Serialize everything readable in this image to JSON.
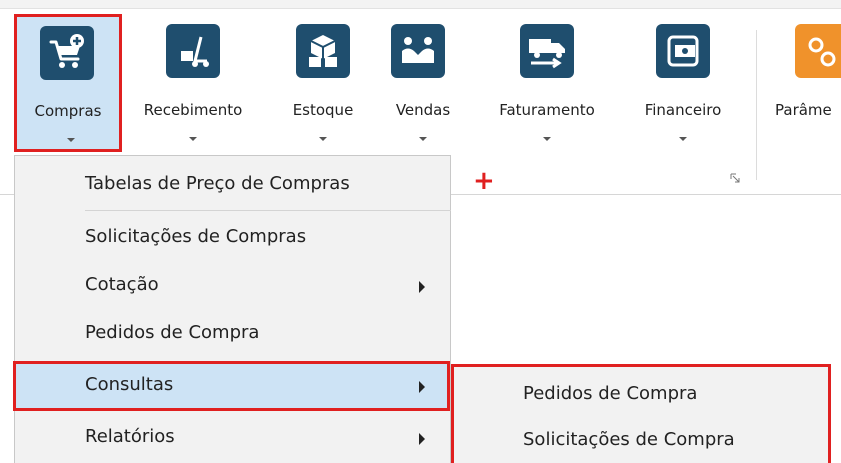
{
  "ribbon": {
    "buttons": [
      {
        "label": "Compras",
        "icon": "shopping-cart-plus-icon"
      },
      {
        "label": "Recebimento",
        "icon": "hand-truck-icon"
      },
      {
        "label": "Estoque",
        "icon": "boxes-icon"
      },
      {
        "label": "Vendas",
        "icon": "handshake-icon"
      },
      {
        "label": "Faturamento",
        "icon": "delivery-truck-icon"
      },
      {
        "label": "Financeiro",
        "icon": "money-icon"
      },
      {
        "label": "Parâme",
        "icon": "settings-gears-icon"
      }
    ]
  },
  "menu": {
    "items": [
      {
        "label": "Tabelas de Preço de Compras"
      },
      {
        "label": "Solicitações de Compras"
      },
      {
        "label": "Cotação"
      },
      {
        "label": "Pedidos de Compra"
      },
      {
        "label": "Consultas"
      },
      {
        "label": "Relatórios"
      }
    ]
  },
  "submenu": {
    "items": [
      {
        "label": "Pedidos de Compra"
      },
      {
        "label": "Solicitações de Compra"
      }
    ]
  },
  "annotation": {
    "plus_symbol": "+"
  },
  "colors": {
    "highlight_red": "#e02020",
    "selected_blue": "#cde3f5",
    "icon_navy": "#1f4e6e",
    "icon_orange": "#f0922b"
  }
}
